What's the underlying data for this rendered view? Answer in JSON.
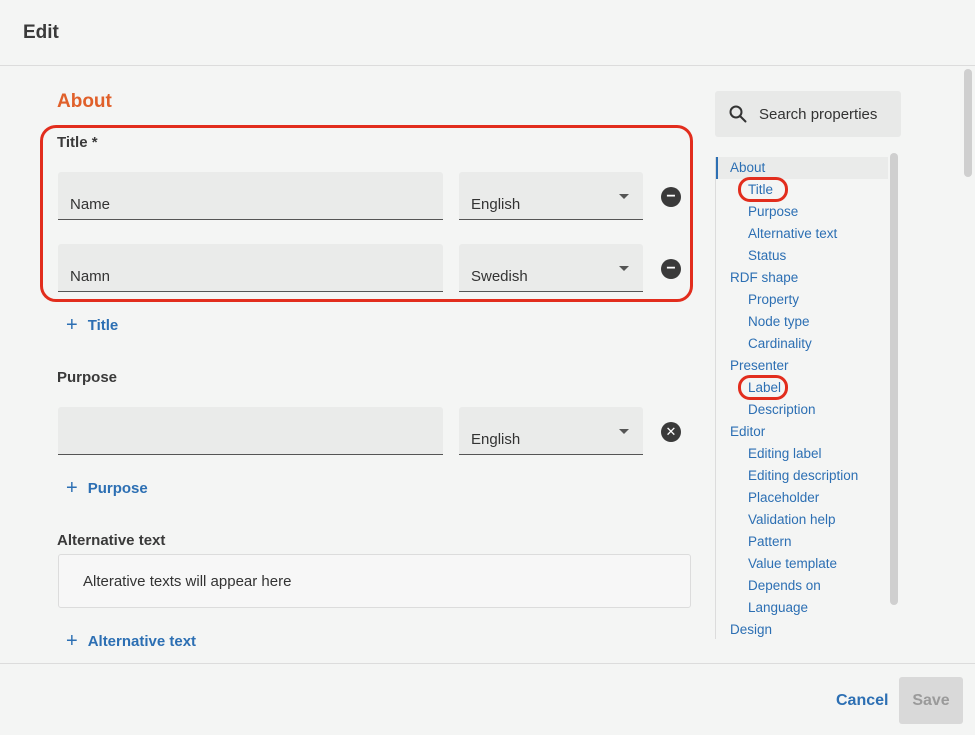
{
  "header": {
    "title": "Edit"
  },
  "main": {
    "section_heading": "About",
    "title_field": {
      "label": "Title *",
      "rows": [
        {
          "value": "Name",
          "language": "English"
        },
        {
          "value": "Namn",
          "language": "Swedish"
        }
      ],
      "add_label": "Title"
    },
    "purpose_field": {
      "label": "Purpose",
      "rows": [
        {
          "value": "",
          "language": "English"
        }
      ],
      "add_label": "Purpose"
    },
    "alt_text_field": {
      "label": "Alternative text",
      "placeholder": "Alterative texts will appear here",
      "add_label": "Alternative text"
    }
  },
  "sidebar": {
    "search_placeholder": "Search properties",
    "toc": [
      {
        "label": "About",
        "level": 0
      },
      {
        "label": "Title",
        "level": 1
      },
      {
        "label": "Purpose",
        "level": 1
      },
      {
        "label": "Alternative text",
        "level": 1
      },
      {
        "label": "Status",
        "level": 1
      },
      {
        "label": "RDF shape",
        "level": 0
      },
      {
        "label": "Property",
        "level": 1
      },
      {
        "label": "Node type",
        "level": 1
      },
      {
        "label": "Cardinality",
        "level": 1
      },
      {
        "label": "Presenter",
        "level": 0
      },
      {
        "label": "Label",
        "level": 1
      },
      {
        "label": "Description",
        "level": 1
      },
      {
        "label": "Editor",
        "level": 0
      },
      {
        "label": "Editing label",
        "level": 1
      },
      {
        "label": "Editing description",
        "level": 1
      },
      {
        "label": "Placeholder",
        "level": 1
      },
      {
        "label": "Validation help",
        "level": 1
      },
      {
        "label": "Pattern",
        "level": 1
      },
      {
        "label": "Value template",
        "level": 1
      },
      {
        "label": "Depends on",
        "level": 1
      },
      {
        "label": "Language",
        "level": 1
      },
      {
        "label": "Design",
        "level": 0
      }
    ]
  },
  "footer": {
    "cancel_label": "Cancel",
    "save_label": "Save"
  },
  "colors": {
    "accent": "#2c6fb3",
    "section_heading": "#e0602a",
    "highlight": "#e22d1d"
  }
}
